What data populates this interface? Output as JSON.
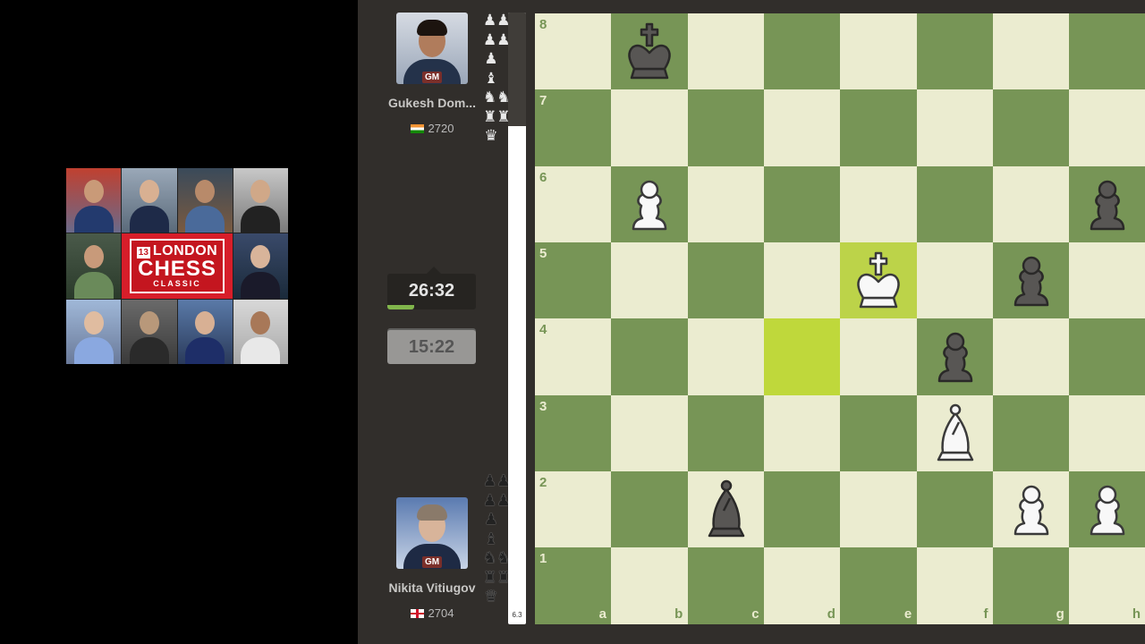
{
  "event": {
    "logo_number": "13",
    "logo_ordinal": "TH",
    "logo_line1": "LONDON",
    "logo_line2": "CHESS",
    "logo_line3": "CLASSIC"
  },
  "players": {
    "top": {
      "name": "Gukesh Dom...",
      "title": "GM",
      "rating": "2720",
      "flag": "india-flag",
      "clock": "26:32",
      "clock_active": true
    },
    "bottom": {
      "name": "Nikita Vitiugov",
      "title": "GM",
      "rating": "2704",
      "flag": "england-flag",
      "clock": "15:22",
      "clock_active": false
    }
  },
  "captured": {
    "top": [
      "♟♟",
      "♟♟",
      "♟",
      "♝",
      "♞♞",
      "♜♜",
      "♛"
    ],
    "bottom": [
      "♟♟",
      "♟♟",
      "♟",
      "♝",
      "♞♞",
      "♜♜",
      "♛"
    ]
  },
  "evaluation": {
    "label": "6.3",
    "white_advantage": 6.3
  },
  "board": {
    "files": [
      "a",
      "b",
      "c",
      "d",
      "e",
      "f",
      "g",
      "h"
    ],
    "ranks": [
      "8",
      "7",
      "6",
      "5",
      "4",
      "3",
      "2",
      "1"
    ],
    "last_move": [
      "d4",
      "e5"
    ],
    "pieces": [
      {
        "square": "b8",
        "piece": "black-king"
      },
      {
        "square": "b6",
        "piece": "white-pawn"
      },
      {
        "square": "h6",
        "piece": "black-pawn"
      },
      {
        "square": "e5",
        "piece": "white-king"
      },
      {
        "square": "g5",
        "piece": "black-pawn"
      },
      {
        "square": "f4",
        "piece": "black-pawn"
      },
      {
        "square": "f3",
        "piece": "white-bishop"
      },
      {
        "square": "c2",
        "piece": "black-bishop"
      },
      {
        "square": "g2",
        "piece": "white-pawn"
      },
      {
        "square": "h2",
        "piece": "white-pawn"
      }
    ]
  },
  "colors": {
    "light_square": "#ebecd0",
    "dark_square": "#779556",
    "highlight": "#b9ca43",
    "panel_bg": "#312e2b"
  }
}
